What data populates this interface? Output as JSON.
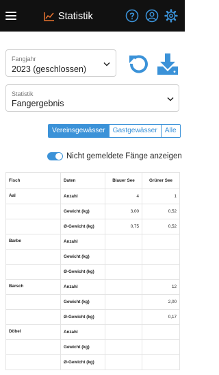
{
  "header": {
    "title": "Statistik",
    "icons": [
      "menu-icon",
      "chart-line-icon",
      "help-icon",
      "user-icon",
      "gear-icon"
    ],
    "accent_color": "#3b92d8",
    "background_color": "#111111"
  },
  "filters": {
    "fangjahr": {
      "label": "Fangjahr",
      "value": "2023 (geschlossen)"
    },
    "statistik": {
      "label": "Statistik",
      "value": "Fangergebnis"
    }
  },
  "actions": {
    "refresh_icon": "refresh-icon",
    "download_icon": "download-icon"
  },
  "segments": [
    {
      "label": "Vereinsgewässer",
      "active": true
    },
    {
      "label": "Gastgewässer",
      "active": false
    },
    {
      "label": "Alle",
      "active": false
    }
  ],
  "toggle": {
    "label": "Nicht gemeldete Fänge anzeigen",
    "on": true
  },
  "table": {
    "headers": [
      "Fisch",
      "Daten",
      "Blauer See",
      "Grüner See"
    ],
    "rows": [
      [
        "Aal",
        "Anzahl",
        "4",
        "1"
      ],
      [
        "",
        "Gewicht (kg)",
        "3,00",
        "0,52"
      ],
      [
        "",
        "Ø-Gewicht (kg)",
        "0,75",
        "0,52"
      ],
      [
        "Barbe",
        "Anzahl",
        "",
        ""
      ],
      [
        "",
        "Gewicht (kg)",
        "",
        ""
      ],
      [
        "",
        "Ø-Gewicht (kg)",
        "",
        ""
      ],
      [
        "Barsch",
        "Anzahl",
        "",
        "12"
      ],
      [
        "",
        "Gewicht (kg)",
        "",
        "2,00"
      ],
      [
        "",
        "Ø-Gewicht (kg)",
        "",
        "0,17"
      ],
      [
        "Döbel",
        "Anzahl",
        "",
        ""
      ],
      [
        "",
        "Gewicht (kg)",
        "",
        ""
      ],
      [
        "",
        "Ø-Gewicht (kg)",
        "",
        ""
      ]
    ]
  }
}
